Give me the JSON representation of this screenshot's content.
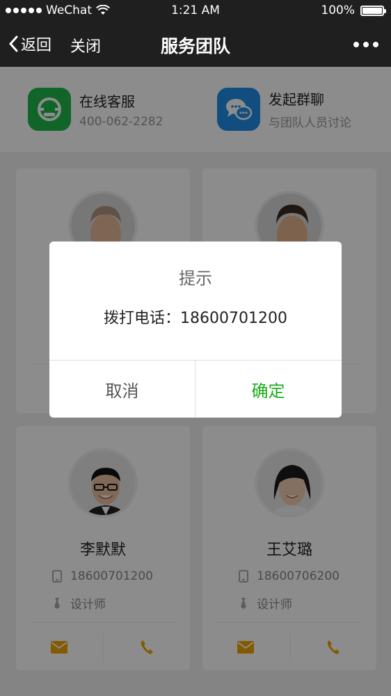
{
  "status": {
    "carrier": "WeChat",
    "time": "1:21 AM",
    "battery": "100%"
  },
  "nav": {
    "back_label": "返回",
    "close_label": "关闭",
    "title": "服务团队"
  },
  "service": [
    {
      "title": "在线客服",
      "subtitle": "400-062-2282",
      "icon": "headset-icon",
      "color": "#1fb94a"
    },
    {
      "title": "发起群聊",
      "subtitle": "与团队人员讨论",
      "icon": "chat-bubbles-icon",
      "color": "#1f8ee8"
    }
  ],
  "members": [
    {
      "name": "",
      "phone": "",
      "role": ""
    },
    {
      "name": "",
      "phone": "",
      "role": ""
    },
    {
      "name": "李默默",
      "phone": "18600701200",
      "role": "设计师"
    },
    {
      "name": "王艾璐",
      "phone": "18600706200",
      "role": "设计师"
    }
  ],
  "dialog": {
    "title": "提示",
    "message": "拨打电话：18600701200",
    "cancel_label": "取消",
    "confirm_label": "确定",
    "confirm_color": "#1aad19"
  },
  "accent_color": "#f0a500"
}
